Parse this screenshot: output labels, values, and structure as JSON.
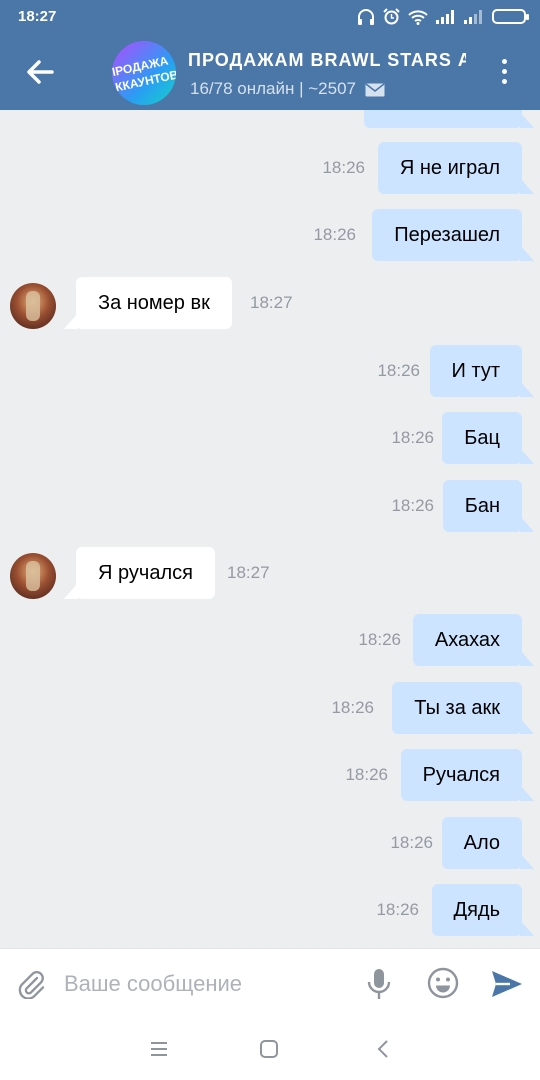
{
  "status_bar": {
    "time": "18:27"
  },
  "header": {
    "group_avatar_text_top": "ПРОДАЖА",
    "group_avatar_text_bottom": "АККАУНТОВ",
    "title": "ПРОДАЖАМ BRAWL STARS А",
    "subtitle": "16/78 онлайн | ~2507"
  },
  "messages": [
    {
      "dir": "out",
      "text": "Я не играл",
      "time": "18:26"
    },
    {
      "dir": "out",
      "text": "Перезашел",
      "time": "18:26"
    },
    {
      "dir": "in",
      "text": "За номер вк",
      "time": "18:27"
    },
    {
      "dir": "out",
      "text": "И тут",
      "time": "18:26"
    },
    {
      "dir": "out",
      "text": "Бац",
      "time": "18:26"
    },
    {
      "dir": "out",
      "text": "Бан",
      "time": "18:26"
    },
    {
      "dir": "in",
      "text": "Я ручался",
      "time": "18:27"
    },
    {
      "dir": "out",
      "text": "Ахахах",
      "time": "18:26"
    },
    {
      "dir": "out",
      "text": "Ты за акк",
      "time": "18:26"
    },
    {
      "dir": "out",
      "text": "Ручался",
      "time": "18:26"
    },
    {
      "dir": "out",
      "text": "Ало",
      "time": "18:26"
    },
    {
      "dir": "out",
      "text": "Дядь",
      "time": "18:26"
    }
  ],
  "input": {
    "placeholder": "Ваше сообщение"
  },
  "icons": {
    "back": "arrow-left-icon",
    "menu": "kebab-menu-icon",
    "attach": "paperclip-icon",
    "mic": "microphone-icon",
    "emoji": "smiley-icon",
    "send": "send-icon"
  },
  "colors": {
    "header": "#4a76a8",
    "outgoing_bubble": "#cce4ff",
    "incoming_bubble": "#ffffff",
    "chat_background": "#edeef0"
  }
}
